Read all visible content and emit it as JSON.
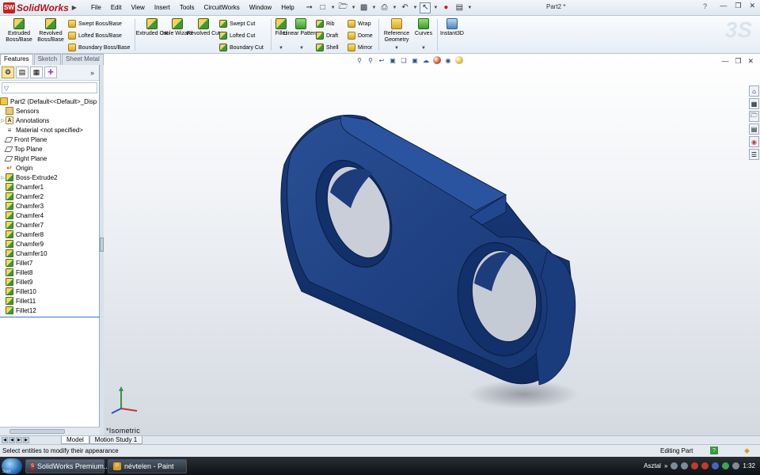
{
  "app": {
    "name": "SolidWorks",
    "logo_badge": "SW",
    "document_title": "Part2 *",
    "menu": [
      "File",
      "Edit",
      "View",
      "Insert",
      "Tools",
      "CircuitWorks",
      "Window",
      "Help"
    ]
  },
  "command_manager": {
    "extruded_boss": "Extruded Boss/Base",
    "revolved_boss": "Revolved Boss/Base",
    "swept_boss": "Swept Boss/Base",
    "lofted_boss": "Lofted Boss/Base",
    "boundary_boss": "Boundary Boss/Base",
    "extruded_cut": "Extruded Cut",
    "hole_wizard": "Hole Wizard",
    "revolved_cut": "Revolved Cut",
    "swept_cut": "Swept Cut",
    "lofted_cut": "Lofted Cut",
    "boundary_cut": "Boundary Cut",
    "fillet": "Fillet",
    "linear_pattern": "Linear Pattern",
    "rib": "Rib",
    "draft": "Draft",
    "shell": "Shell",
    "wrap": "Wrap",
    "dome": "Dome",
    "mirror": "Mirror",
    "reference_geometry": "Reference Geometry",
    "curves": "Curves",
    "instant3d": "Instant3D"
  },
  "panel_tabs": [
    "Features",
    "Sketch",
    "Sheet Metal"
  ],
  "tree": {
    "root": "Part2  (Default<<Default>_Disp",
    "items": [
      {
        "label": "Sensors",
        "icon": "sensors-icon"
      },
      {
        "label": "Annotations",
        "icon": "annotations-icon"
      },
      {
        "label": "Material <not specified>",
        "icon": "material-icon"
      },
      {
        "label": "Front Plane",
        "icon": "plane-icon"
      },
      {
        "label": "Top Plane",
        "icon": "plane-icon"
      },
      {
        "label": "Right Plane",
        "icon": "plane-icon"
      },
      {
        "label": "Origin",
        "icon": "origin-icon"
      },
      {
        "label": "Boss-Extrude2",
        "icon": "feature-icon"
      },
      {
        "label": "Chamfer1",
        "icon": "feature-icon"
      },
      {
        "label": "Chamfer2",
        "icon": "feature-icon"
      },
      {
        "label": "Chamfer3",
        "icon": "feature-icon"
      },
      {
        "label": "Chamfer4",
        "icon": "feature-icon"
      },
      {
        "label": "Chamfer7",
        "icon": "feature-icon"
      },
      {
        "label": "Chamfer8",
        "icon": "feature-icon"
      },
      {
        "label": "Chamfer9",
        "icon": "feature-icon"
      },
      {
        "label": "Chamfer10",
        "icon": "feature-icon"
      },
      {
        "label": "Fillet7",
        "icon": "feature-icon"
      },
      {
        "label": "Fillet8",
        "icon": "feature-icon"
      },
      {
        "label": "Fillet9",
        "icon": "feature-icon"
      },
      {
        "label": "Fillet10",
        "icon": "feature-icon"
      },
      {
        "label": "Fillet11",
        "icon": "feature-icon"
      },
      {
        "label": "Fillet12",
        "icon": "feature-icon"
      }
    ]
  },
  "viewport": {
    "view_label": "*Isometric",
    "model_color": "#1c3a78"
  },
  "bottom_tabs": [
    "Model",
    "Motion Study 1"
  ],
  "status": {
    "message": "Select entities to modify their appearance",
    "mode": "Editing Part"
  },
  "taskbar": {
    "start_label": "Start",
    "buttons": [
      "SolidWorks Premium...",
      "névtelen - Paint"
    ],
    "tray_text": "Asztal",
    "clock": "1:32"
  }
}
